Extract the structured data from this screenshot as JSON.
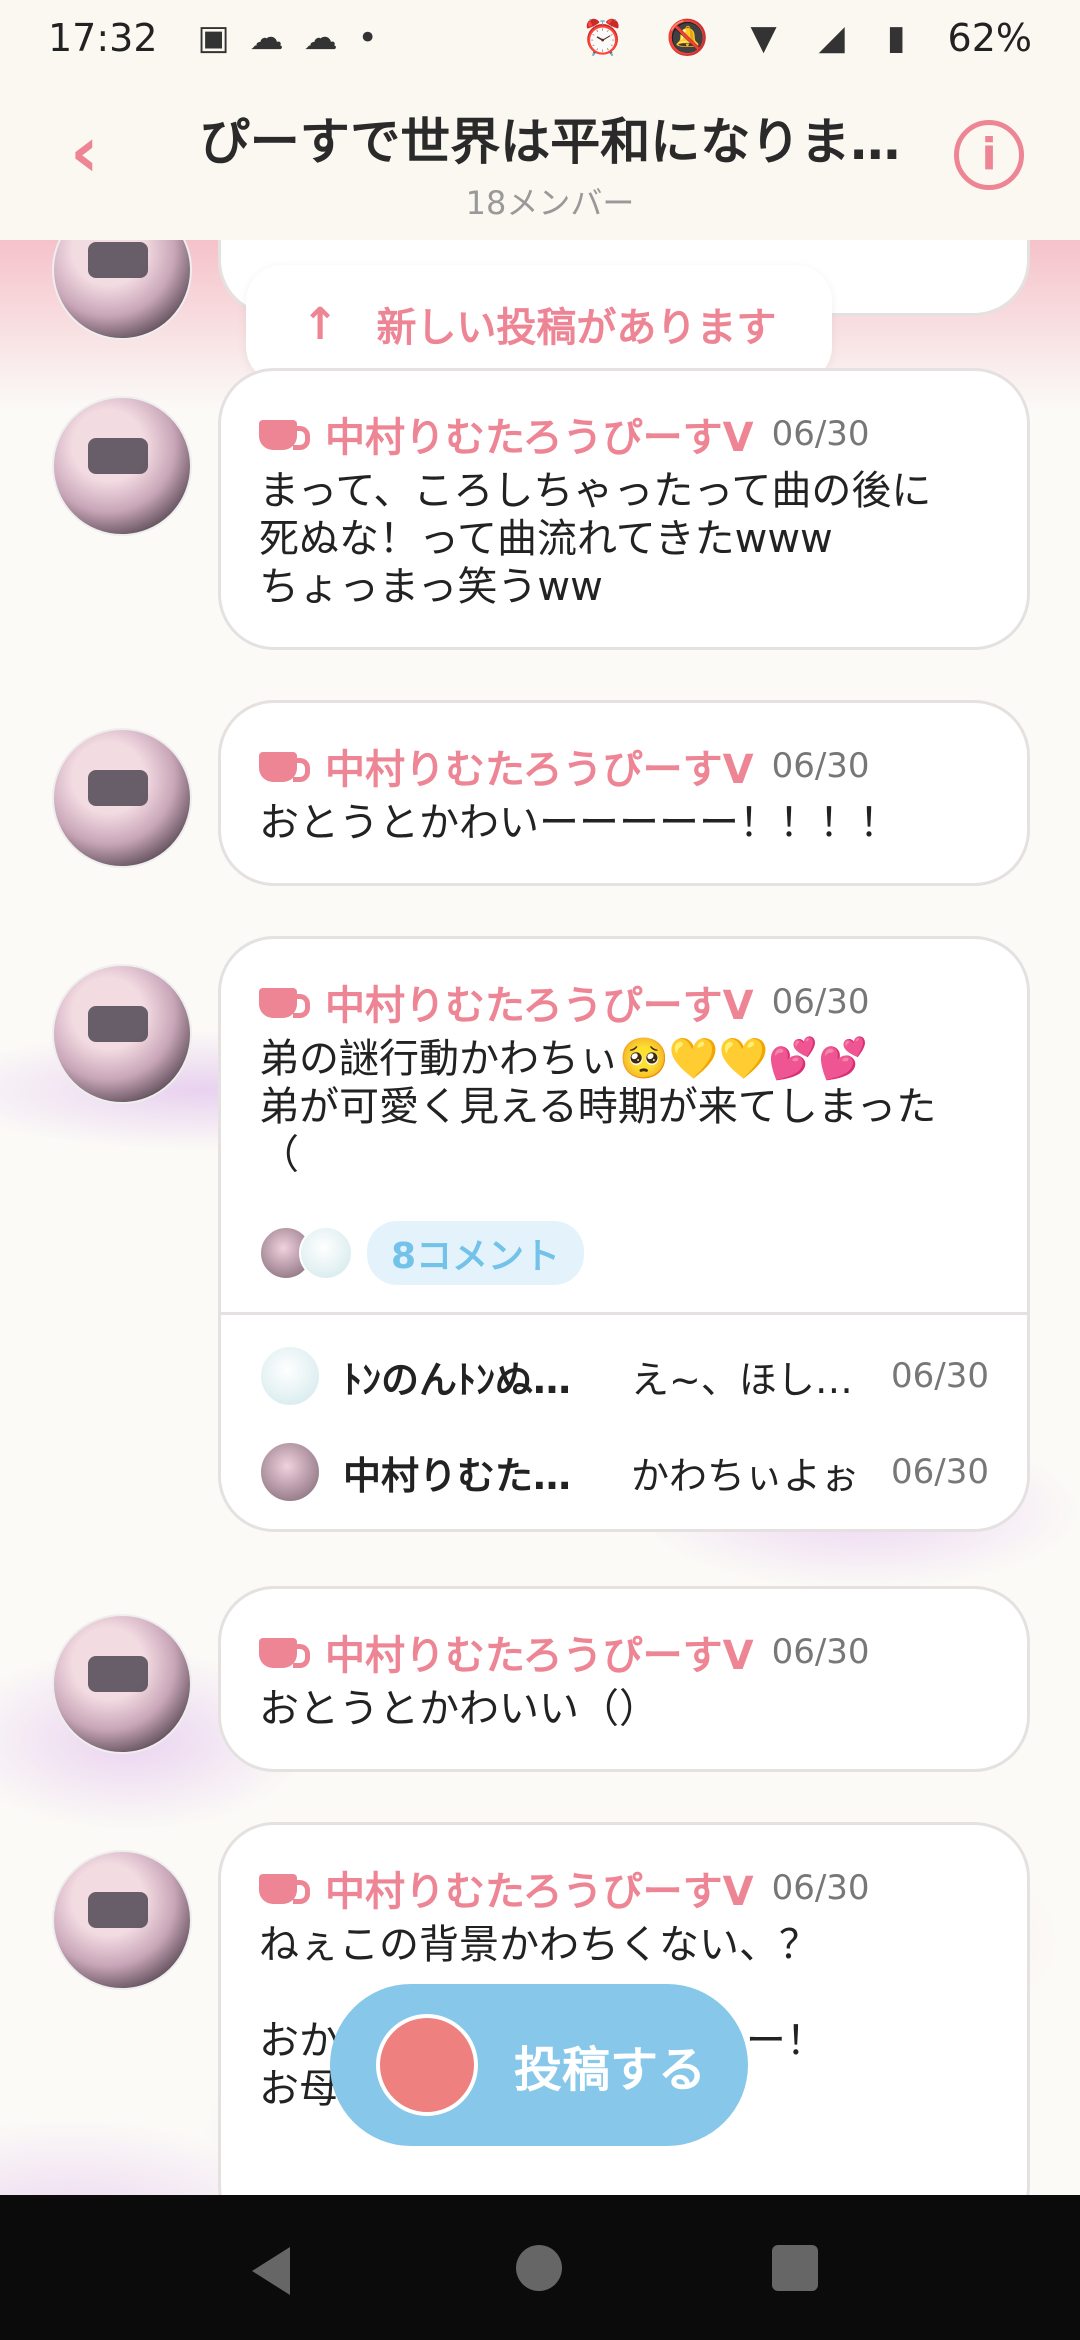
{
  "status_bar": {
    "time": "17:32",
    "battery": "62%",
    "left_icons": [
      "app-icon",
      "cloud-sun-icon",
      "cloud-sun-icon",
      "dot-icon"
    ],
    "right_icons": [
      "alarm-icon",
      "bell-off-icon",
      "wifi-icon",
      "signal-icon",
      "battery-icon"
    ]
  },
  "header": {
    "title": "ぴーすで世界は平和になりま…",
    "members": "18メンバー"
  },
  "banner": {
    "label": "新しい投稿があります"
  },
  "posts": [
    {
      "author": "中村りむたろうぴーすV",
      "date": "06/30",
      "text": "まって、ころしちゃったって曲の後に\n死ぬな！って曲流れてきたwww\nちょっまっ笑うww"
    },
    {
      "author": "中村りむたろうぴーすV",
      "date": "06/30",
      "text": "おとうとかわいーーーーー！！！！"
    },
    {
      "author": "中村りむたろうぴーすV",
      "date": "06/30",
      "text": "弟の謎行動かわちぃ🥺💛💛💕💕\n弟が可愛く見える時期が来てしまった\n（",
      "comment_count": "8コメント",
      "comments": [
        {
          "name": "ﾄﾝのんﾄﾝぬ…",
          "text": "え~、ほし…",
          "date": "06/30"
        },
        {
          "name": "中村りむた…",
          "text": "かわちぃよぉ",
          "date": "06/30"
        }
      ]
    },
    {
      "author": "中村りむたろうぴーすV",
      "date": "06/30",
      "text": "おとうとかわいい（）"
    },
    {
      "author": "中村りむたろうぴーすV",
      "date": "06/30",
      "text": "ねぇこの背景かわちくない、？\n\nおか                                ー！\nお母"
    }
  ],
  "fab": {
    "label": "投稿する"
  },
  "colors": {
    "accent": "#ee8595",
    "fab": "#86c7ea",
    "comment_badge": "#72c2ea"
  }
}
